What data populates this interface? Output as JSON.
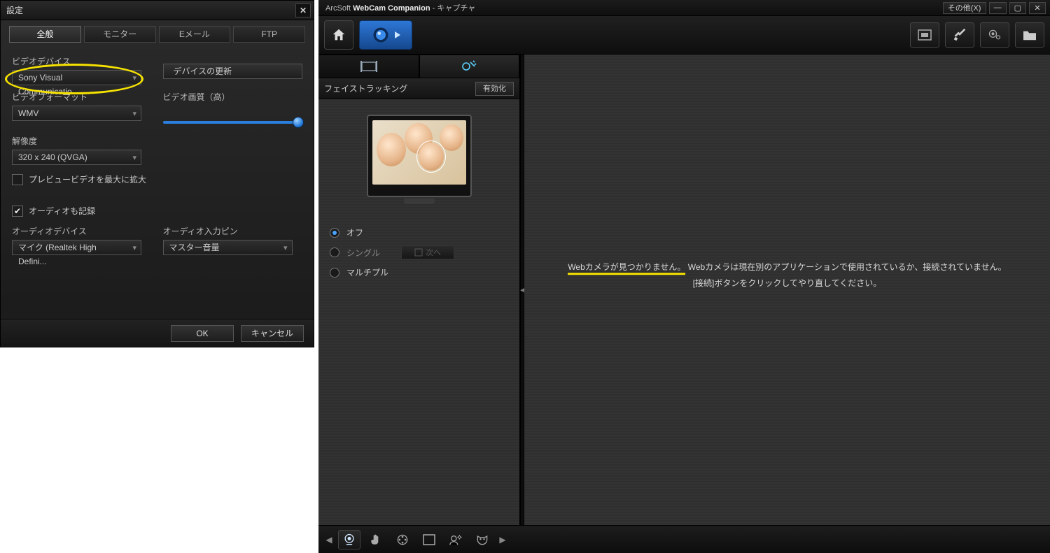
{
  "dialog": {
    "title": "設定",
    "tabs": {
      "general": "全般",
      "monitor": "モニター",
      "email": "Eメール",
      "ftp": "FTP"
    },
    "videoDeviceLabel": "ビデオデバイス",
    "videoDeviceValue": "Sony Visual Communicatio...",
    "refreshDeviceBtn": "デバイスの更新",
    "videoFormatLabel": "ビデオフォーマット",
    "videoFormatValue": "WMV",
    "videoQualityLabel": "ビデオ画質（高）",
    "resolutionLabel": "解像度",
    "resolutionValue": "320 x 240 (QVGA)",
    "expandPreviewLabel": "プレビュービデオを最大に拡大",
    "recordAudioLabel": "オーディオも記録",
    "audioDeviceLabel": "オーディオデバイス",
    "audioDeviceValue": "マイク (Realtek High Defini...",
    "audioPinLabel": "オーディオ入力ピン",
    "audioPinValue": "マスター音量",
    "ok": "OK",
    "cancel": "キャンセル"
  },
  "main": {
    "titlePrefix": "ArcSoft ",
    "titleBold": "WebCam Companion",
    "titleSuffix": " - キャプチャ",
    "otherBtn": "その他(X)",
    "sidebar": {
      "faceTracking": "フェイストラッキング",
      "enable": "有効化",
      "radios": {
        "off": "オフ",
        "single": "シングル",
        "multiple": "マルチプル"
      },
      "next": "次へ"
    },
    "error": {
      "line1a": "Webカメラが見つかりません。",
      "line1b": "Webカメラは現在別のアプリケーションで使用されているか、接続されていません。",
      "line2": "[接続]ボタンをクリックしてやり直してください。"
    }
  }
}
